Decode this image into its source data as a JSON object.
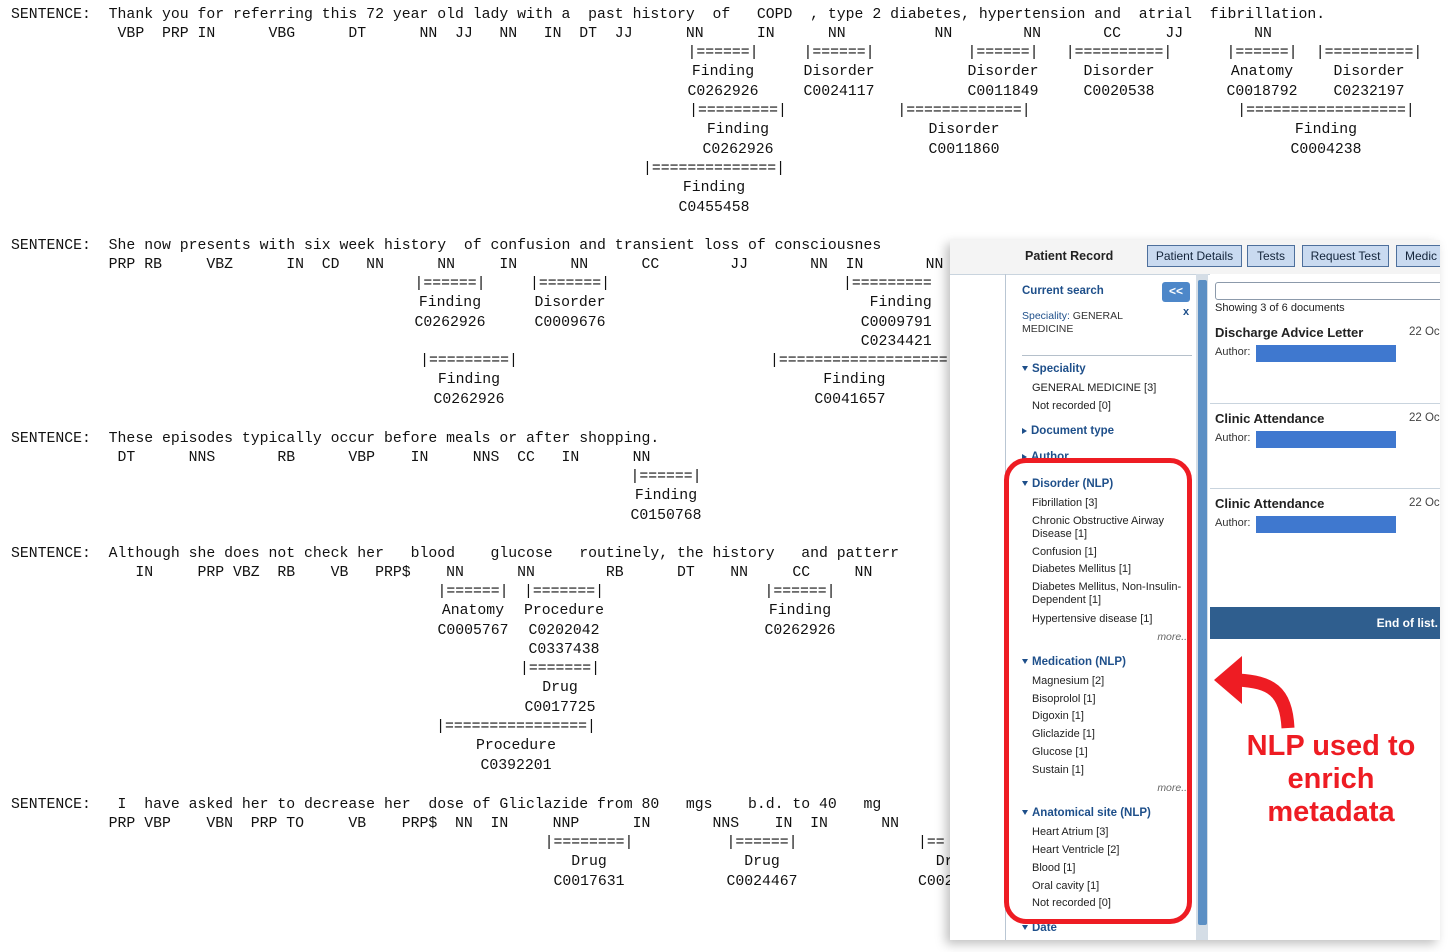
{
  "nlp_output": {
    "blocks": [
      {
        "tokens": "SENTENCE:  Thank you for referring this 72 year old lady with a  past history  of   COPD  , type 2 diabetes, hypertension and  atrial  fibrillation.",
        "tags": "            VBP  PRP IN      VBG      DT      NN  JJ   NN   IN  DT  JJ      NN      IN      NN          NN        NN       CC     JJ        NN",
        "labels": [
          [
            "|======|",
            "Finding",
            "C0262926"
          ],
          [
            "|======|",
            "Disorder",
            "C0024117"
          ],
          [
            "|======|",
            "Disorder",
            "C0011849"
          ],
          [
            "|==========|",
            "Disorder",
            "C0020538"
          ],
          [
            "|======|",
            "Anatomy",
            "C0018792"
          ],
          [
            "|==========|",
            "Disorder",
            "C0232197"
          ],
          [
            "|=========|",
            "Finding",
            "C0262926"
          ],
          [
            "|=============|",
            "Disorder",
            "C0011860"
          ],
          [
            "|==================|",
            "Finding",
            "C0004238"
          ],
          [
            "|==============|",
            "Finding",
            "C0455458"
          ]
        ]
      },
      {
        "tokens": "SENTENCE:  She now presents with six week history  of confusion and transient loss of consciousnes",
        "tags": "           PRP RB     VBZ      IN  CD   NN      NN     IN      NN      CC        JJ       NN  IN       NN",
        "labels": [
          [
            "|======|",
            "Finding",
            "C0262926"
          ],
          [
            "|=======|",
            "Disorder",
            "C0009676"
          ],
          [
            "|=========",
            "Finding",
            "C0009791",
            "C0234421"
          ],
          [
            "|=========|",
            "Finding",
            "C0262926"
          ],
          [
            "|===================",
            "Finding",
            "C0041657"
          ]
        ]
      },
      {
        "tokens": "SENTENCE:  These episodes typically occur before meals or after shopping.",
        "tags": "            DT      NNS       RB      VBP    IN     NNS  CC   IN      NN",
        "labels": [
          [
            "|======|",
            "Finding",
            "C0150768"
          ]
        ]
      },
      {
        "tokens": "SENTENCE:  Although she does not check her   blood    glucose   routinely, the history   and patterr",
        "tags": "              IN     PRP VBZ  RB    VB   PRP$    NN      NN        RB      DT    NN     CC     NN",
        "labels": [
          [
            "|======|",
            "Anatomy",
            "C0005767"
          ],
          [
            "|=======|",
            "Procedure",
            "C0202042",
            "C0337438"
          ],
          [
            "|======|",
            "Finding",
            "C0262926"
          ],
          [
            "|=======|",
            "Drug",
            "C0017725"
          ],
          [
            "|================|",
            "Procedure",
            "C0392201"
          ]
        ]
      },
      {
        "tokens": "SENTENCE:   I  have asked her to decrease her  dose of Gliclazide from 80   mgs    b.d. to 40   mg",
        "tags": "           PRP VBP    VBN  PRP TO     VB    PRP$  NN  IN     NNP      IN       NNS    IN  IN      NN",
        "labels": [
          [
            "|========|",
            "Drug",
            "C0017631"
          ],
          [
            "|======|",
            "Drug",
            "C0024467"
          ],
          [
            "|==",
            "Dr",
            "C002"
          ]
        ]
      }
    ]
  },
  "app": {
    "title": "Patient Record",
    "buttons": [
      "Patient Details",
      "Tests",
      "Request Test",
      "Medic"
    ],
    "sidebar": {
      "current_search_label": "Current search",
      "collapse_label": "<<",
      "close_label": "x",
      "speciality_filter_label": "Speciality:",
      "speciality_filter_value": "GENERAL MEDICINE",
      "more_label": "more...",
      "facets": [
        {
          "title": "Speciality",
          "expanded": true,
          "items": [
            "GENERAL MEDICINE [3]",
            "Not recorded [0]"
          ]
        },
        {
          "title": "Document type",
          "expanded": false,
          "items": []
        },
        {
          "title": "Author",
          "expanded": false,
          "items": []
        },
        {
          "title": "Disorder (NLP)",
          "expanded": true,
          "items": [
            "Fibrillation [3]",
            "Chronic Obstructive Airway Disease [1]",
            "Confusion [1]",
            "Diabetes Mellitus [1]",
            "Diabetes Mellitus, Non-Insulin-Dependent [1]",
            "Hypertensive disease [1]"
          ]
        },
        {
          "title": "Medication (NLP)",
          "expanded": true,
          "items": [
            "Magnesium [2]",
            "Bisoprolol [1]",
            "Digoxin [1]",
            "Gliclazide [1]",
            "Glucose [1]",
            "Sustain [1]"
          ]
        },
        {
          "title": "Anatomical site (NLP)",
          "expanded": true,
          "items": [
            "Heart Atrium [3]",
            "Heart Ventricle [2]",
            "Blood [1]",
            "Oral cavity [1]",
            "Not recorded [0]"
          ]
        },
        {
          "title": "Date",
          "expanded": false,
          "items": []
        }
      ]
    },
    "documents": {
      "showing": "Showing 3 of 6 documents",
      "author_label": "Author:",
      "items": [
        {
          "title": "Discharge Advice Letter",
          "date": "22 Oc"
        },
        {
          "title": "Clinic Attendance",
          "date": "22 Oc"
        },
        {
          "title": "Clinic Attendance",
          "date": "22 Oc"
        }
      ],
      "end_label": "End of list."
    }
  },
  "annotation": {
    "text": "NLP used to enrich metadata",
    "color": "#ee1c23"
  },
  "colors": {
    "accent": "#1e4f8a",
    "button_fill": "#c9daf0",
    "end_bar": "#2f5e8e",
    "redaction": "#3f78cf"
  }
}
